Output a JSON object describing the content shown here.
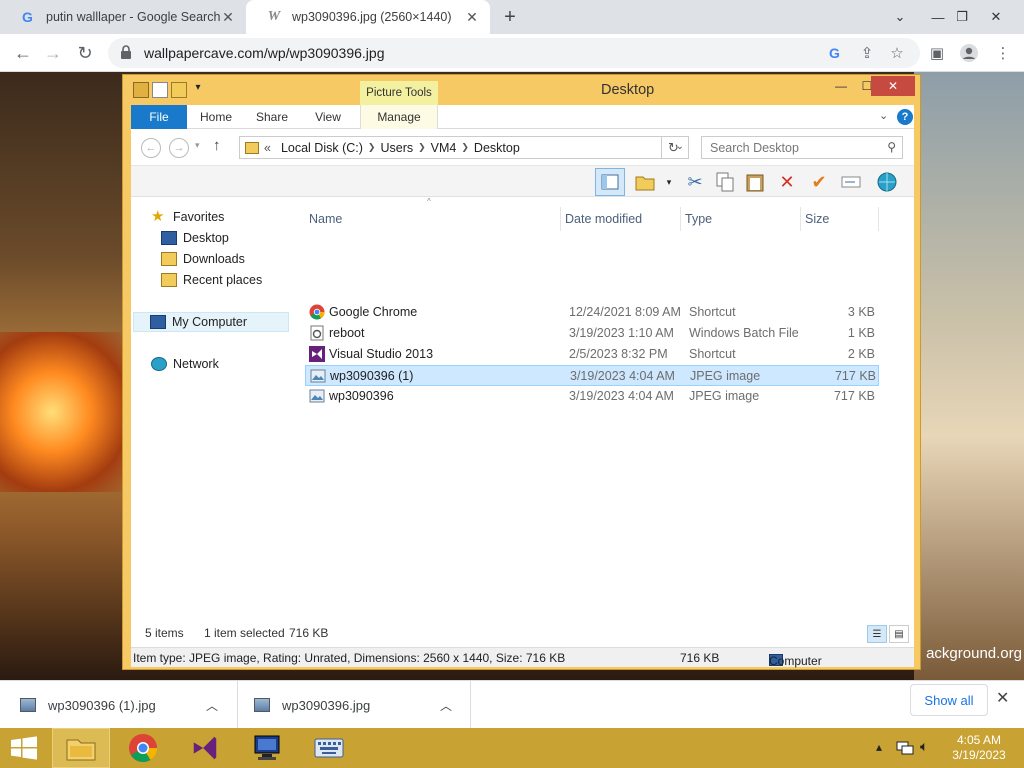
{
  "browser": {
    "tabs": [
      {
        "title": "putin walllaper - Google Search",
        "active": false
      },
      {
        "title": "wp3090396.jpg (2560×1440)",
        "active": true
      }
    ],
    "url": "wallpapercave.com/wp/wp3090396.jpg"
  },
  "wallpaper": {
    "caption": "ackground.org"
  },
  "explorer": {
    "title": "Desktop",
    "contextual_tab": "Picture Tools",
    "ribbon_tabs": [
      "File",
      "Home",
      "Share",
      "View",
      "Manage"
    ],
    "address": {
      "prefix": "«",
      "segments": [
        "Local Disk (C:)",
        "Users",
        "VM4",
        "Desktop"
      ]
    },
    "search_placeholder": "Search Desktop",
    "nav": {
      "favorites": "Favorites",
      "favorites_items": [
        "Desktop",
        "Downloads",
        "Recent places"
      ],
      "computer": "My Computer",
      "network": "Network"
    },
    "columns": [
      "Name",
      "Date modified",
      "Type",
      "Size"
    ],
    "files": [
      {
        "name": "Google Chrome",
        "date": "12/24/2021 8:09 AM",
        "type": "Shortcut",
        "size": "3 KB",
        "icon": "chrome-icon"
      },
      {
        "name": "reboot",
        "date": "3/19/2023 1:10 AM",
        "type": "Windows Batch File",
        "size": "1 KB",
        "icon": "batch-file-icon"
      },
      {
        "name": "Visual Studio 2013",
        "date": "2/5/2023 8:32 PM",
        "type": "Shortcut",
        "size": "2 KB",
        "icon": "visual-studio-icon"
      },
      {
        "name": "wp3090396 (1)",
        "date": "3/19/2023 4:04 AM",
        "type": "JPEG image",
        "size": "717 KB",
        "icon": "image-file-icon",
        "selected": true
      },
      {
        "name": "wp3090396",
        "date": "3/19/2023 4:04 AM",
        "type": "JPEG image",
        "size": "717 KB",
        "icon": "image-file-icon"
      }
    ],
    "status": {
      "items": "5 items",
      "selected": "1 item selected",
      "selected_size": "716 KB"
    },
    "details": {
      "text": "Item type: JPEG image, Rating: Unrated, Dimensions: 2560 x 1440, Size: 716 KB",
      "size": "716 KB",
      "location": "Computer"
    }
  },
  "downloads": {
    "items": [
      "wp3090396 (1).jpg",
      "wp3090396.jpg"
    ],
    "show_all": "Show all"
  },
  "taskbar": {
    "time": "4:05 AM",
    "date": "3/19/2023"
  },
  "colors": {
    "explorer_frame": "#f6c964",
    "file_tab": "#1979ca",
    "selection": "#cde8ff",
    "taskbar": "#c9a234"
  }
}
